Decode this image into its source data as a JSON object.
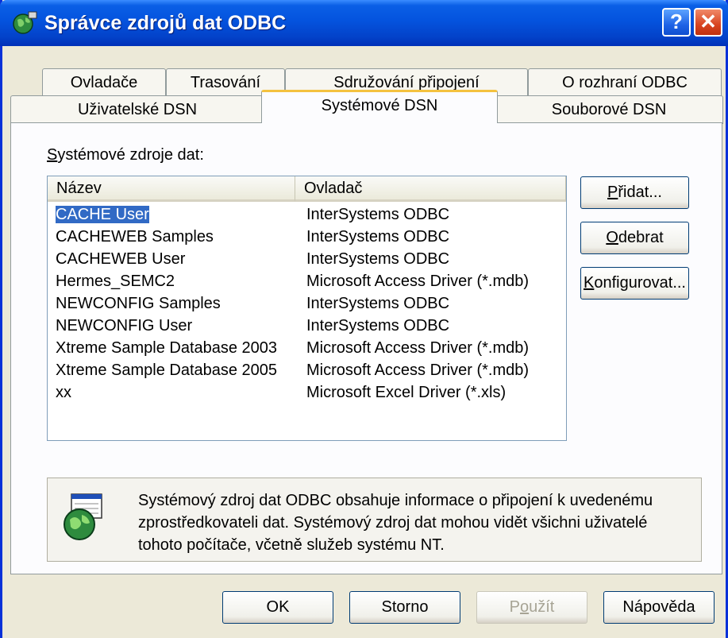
{
  "window": {
    "title": "Správce zdrojů dat ODBC"
  },
  "titlebar_buttons": {
    "help": "?",
    "close": "✕"
  },
  "tabs_back": [
    "Ovladače",
    "Trasování",
    "Sdružování připojení",
    "O rozhraní ODBC"
  ],
  "tabs_front": [
    "Uživatelské DSN",
    "Systémové DSN",
    "Souborové DSN"
  ],
  "selected_tab": "Systémové DSN",
  "list": {
    "label_prefix": "S",
    "label_rest": "ystémové zdroje dat:",
    "columns": [
      "Název",
      "Ovladač"
    ],
    "rows": [
      {
        "name": "CACHE User",
        "driver": "InterSystems ODBC",
        "selected": true
      },
      {
        "name": "CACHEWEB Samples",
        "driver": "InterSystems ODBC"
      },
      {
        "name": "CACHEWEB User",
        "driver": "InterSystems ODBC"
      },
      {
        "name": "Hermes_SEMC2",
        "driver": "Microsoft Access Driver (*.mdb)"
      },
      {
        "name": "NEWCONFIG Samples",
        "driver": "InterSystems ODBC"
      },
      {
        "name": "NEWCONFIG User",
        "driver": "InterSystems ODBC"
      },
      {
        "name": "Xtreme Sample Database 2003",
        "driver": "Microsoft Access Driver (*.mdb)"
      },
      {
        "name": "Xtreme Sample Database 2005",
        "driver": "Microsoft Access Driver (*.mdb)"
      },
      {
        "name": "xx",
        "driver": "Microsoft Excel Driver (*.xls)"
      }
    ]
  },
  "side_buttons": {
    "add": {
      "u": "P",
      "rest": "řidat..."
    },
    "remove": {
      "u": "O",
      "rest": "debrat"
    },
    "configure": {
      "u": "K",
      "rest": "onfigurovat..."
    }
  },
  "info": {
    "text": "Systémový zdroj dat ODBC obsahuje informace o připojení k uvedenému zprostředkovateli dat. Systémový zdroj dat mohou vidět všichni uživatelé tohoto počítače, včetně služeb systému NT."
  },
  "bottom_buttons": {
    "ok": "OK",
    "cancel": "Storno",
    "apply_pre": "P",
    "apply_u": "o",
    "apply_rest": "užít",
    "help": "Nápověda"
  },
  "colors": {
    "titlebar": "#0453de",
    "selection": "#316ac5",
    "face": "#ece9d8"
  }
}
